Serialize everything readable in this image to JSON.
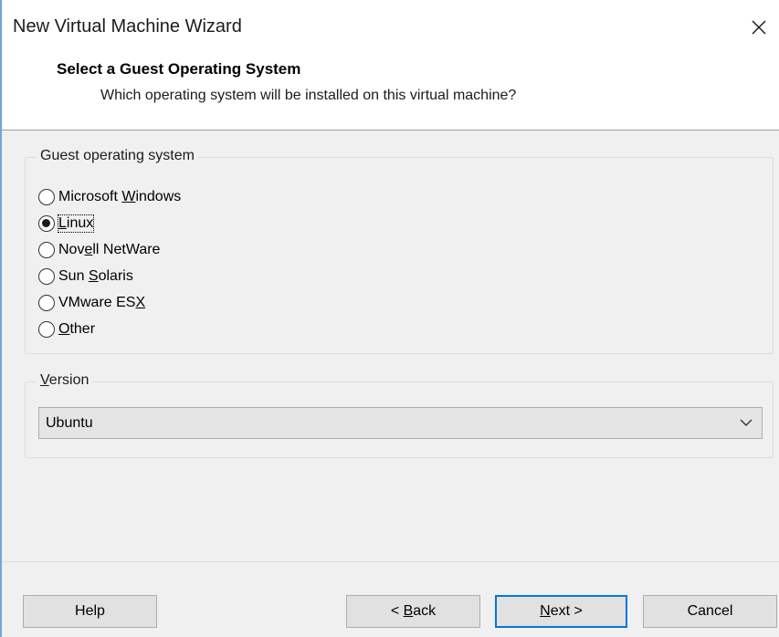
{
  "window": {
    "title": "New Virtual Machine Wizard"
  },
  "header": {
    "title": "Select a Guest Operating System",
    "subtitle": "Which operating system will be installed on this virtual machine?"
  },
  "guest_os": {
    "group_label": "Guest operating system",
    "options": [
      {
        "pre": "Microsoft ",
        "key": "W",
        "post": "indows",
        "checked": false
      },
      {
        "pre": "",
        "key": "L",
        "post": "inux",
        "checked": true
      },
      {
        "pre": "Nov",
        "key": "e",
        "post": "ll NetWare",
        "checked": false
      },
      {
        "pre": "Sun ",
        "key": "S",
        "post": "olaris",
        "checked": false
      },
      {
        "pre": "VMware ES",
        "key": "X",
        "post": "",
        "checked": false
      },
      {
        "pre": "",
        "key": "O",
        "post": "ther",
        "checked": false
      }
    ]
  },
  "version": {
    "group_label_key": "V",
    "group_label_rest": "ersion",
    "selected": "Ubuntu"
  },
  "buttons": {
    "help": "Help",
    "back_pre": "< ",
    "back_key": "B",
    "back_post": "ack",
    "next_key": "N",
    "next_post": "ext >",
    "cancel": "Cancel"
  },
  "colors": {
    "accent": "#0078d7",
    "window_border": "#6fa8dc",
    "panel": "#f0f0f0"
  }
}
